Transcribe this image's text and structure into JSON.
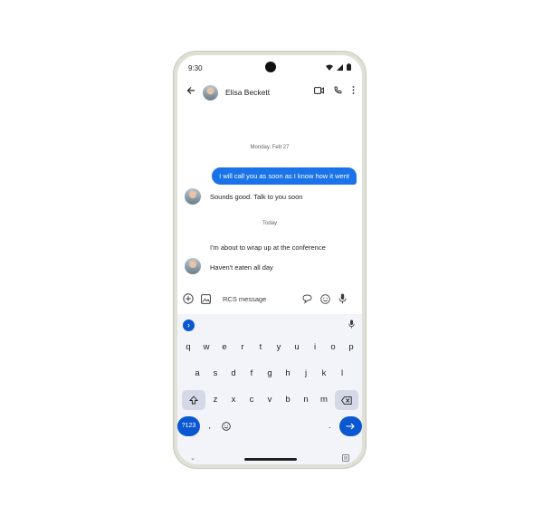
{
  "status_bar": {
    "time": "9:30"
  },
  "app_bar": {
    "contact_name": "Elisa Beckett"
  },
  "conversation": {
    "dates": [
      "Monday, Feb 27",
      "Today"
    ],
    "messages": [
      {
        "direction": "outgoing",
        "text": "I will call you as soon as I know how it went"
      },
      {
        "direction": "incoming",
        "text": "Sounds good. Talk to you soon"
      },
      {
        "direction": "outgoing_draft",
        "text": "I'm about to wrap up at the conference"
      },
      {
        "direction": "incoming",
        "text": "Haven't eaten all day"
      }
    ]
  },
  "compose": {
    "placeholder": "RCS message"
  },
  "keyboard": {
    "row1": [
      "q",
      "w",
      "e",
      "r",
      "t",
      "y",
      "u",
      "i",
      "o",
      "p"
    ],
    "row2": [
      "a",
      "s",
      "d",
      "f",
      "g",
      "h",
      "j",
      "k",
      "l"
    ],
    "row3": [
      "z",
      "x",
      "c",
      "v",
      "b",
      "n",
      "m"
    ],
    "symbols_key": "?123",
    "comma": ",",
    "period": "."
  },
  "colors": {
    "accent": "#1a73e8",
    "keyboard_bg": "#f3f4f9"
  },
  "icons": [
    "back-arrow-icon",
    "video-call-icon",
    "phone-icon",
    "more-vert-icon",
    "add-circle-icon",
    "gallery-icon",
    "rcs-icon",
    "emoji-icon",
    "mic-icon",
    "shift-icon",
    "backspace-icon",
    "enter-arrow-icon"
  ]
}
